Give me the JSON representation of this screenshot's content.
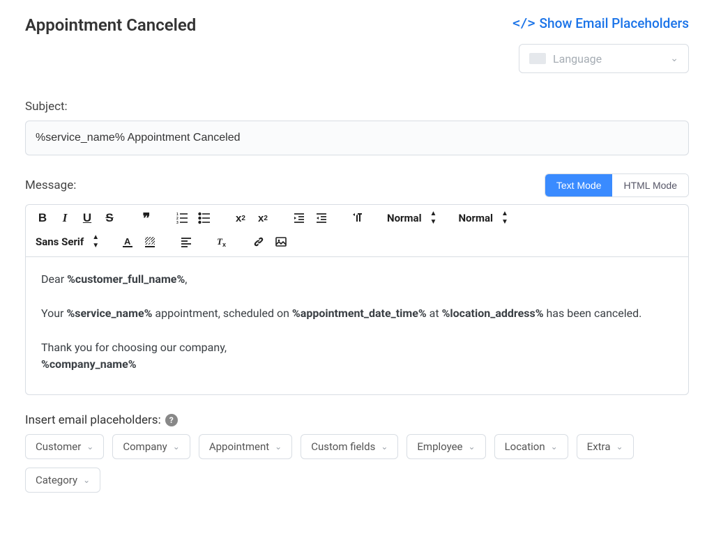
{
  "header": {
    "title": "Appointment Canceled",
    "show_placeholders_label": "Show Email Placeholders",
    "code_icon": "</>"
  },
  "language": {
    "placeholder": "Language"
  },
  "subject": {
    "label": "Subject:",
    "value": "%service_name% Appointment Canceled"
  },
  "message": {
    "label": "Message:",
    "modes": {
      "text": "Text Mode",
      "html": "HTML Mode"
    },
    "active_mode": "text",
    "toolbar": {
      "heading_select": "Normal",
      "size_select": "Normal",
      "font_select": "Sans Serif"
    },
    "body_segments": {
      "l1a": "Dear ",
      "l1b": "%customer_full_name%",
      "l1c": ",",
      "l2a": "Your ",
      "l2b": "%service_name%",
      "l2c": " appointment, scheduled on ",
      "l2d": "%appointment_date_time%",
      "l2e": " at ",
      "l2f": "%location_address%",
      "l2g": " has been canceled.",
      "l3": "Thank you for choosing our company,",
      "l4": "%company_name%"
    }
  },
  "insert": {
    "label": "Insert email placeholders:",
    "chips": {
      "customer": "Customer",
      "company": "Company",
      "appointment": "Appointment",
      "custom_fields": "Custom fields",
      "employee": "Employee",
      "location": "Location",
      "extra": "Extra",
      "category": "Category"
    }
  }
}
